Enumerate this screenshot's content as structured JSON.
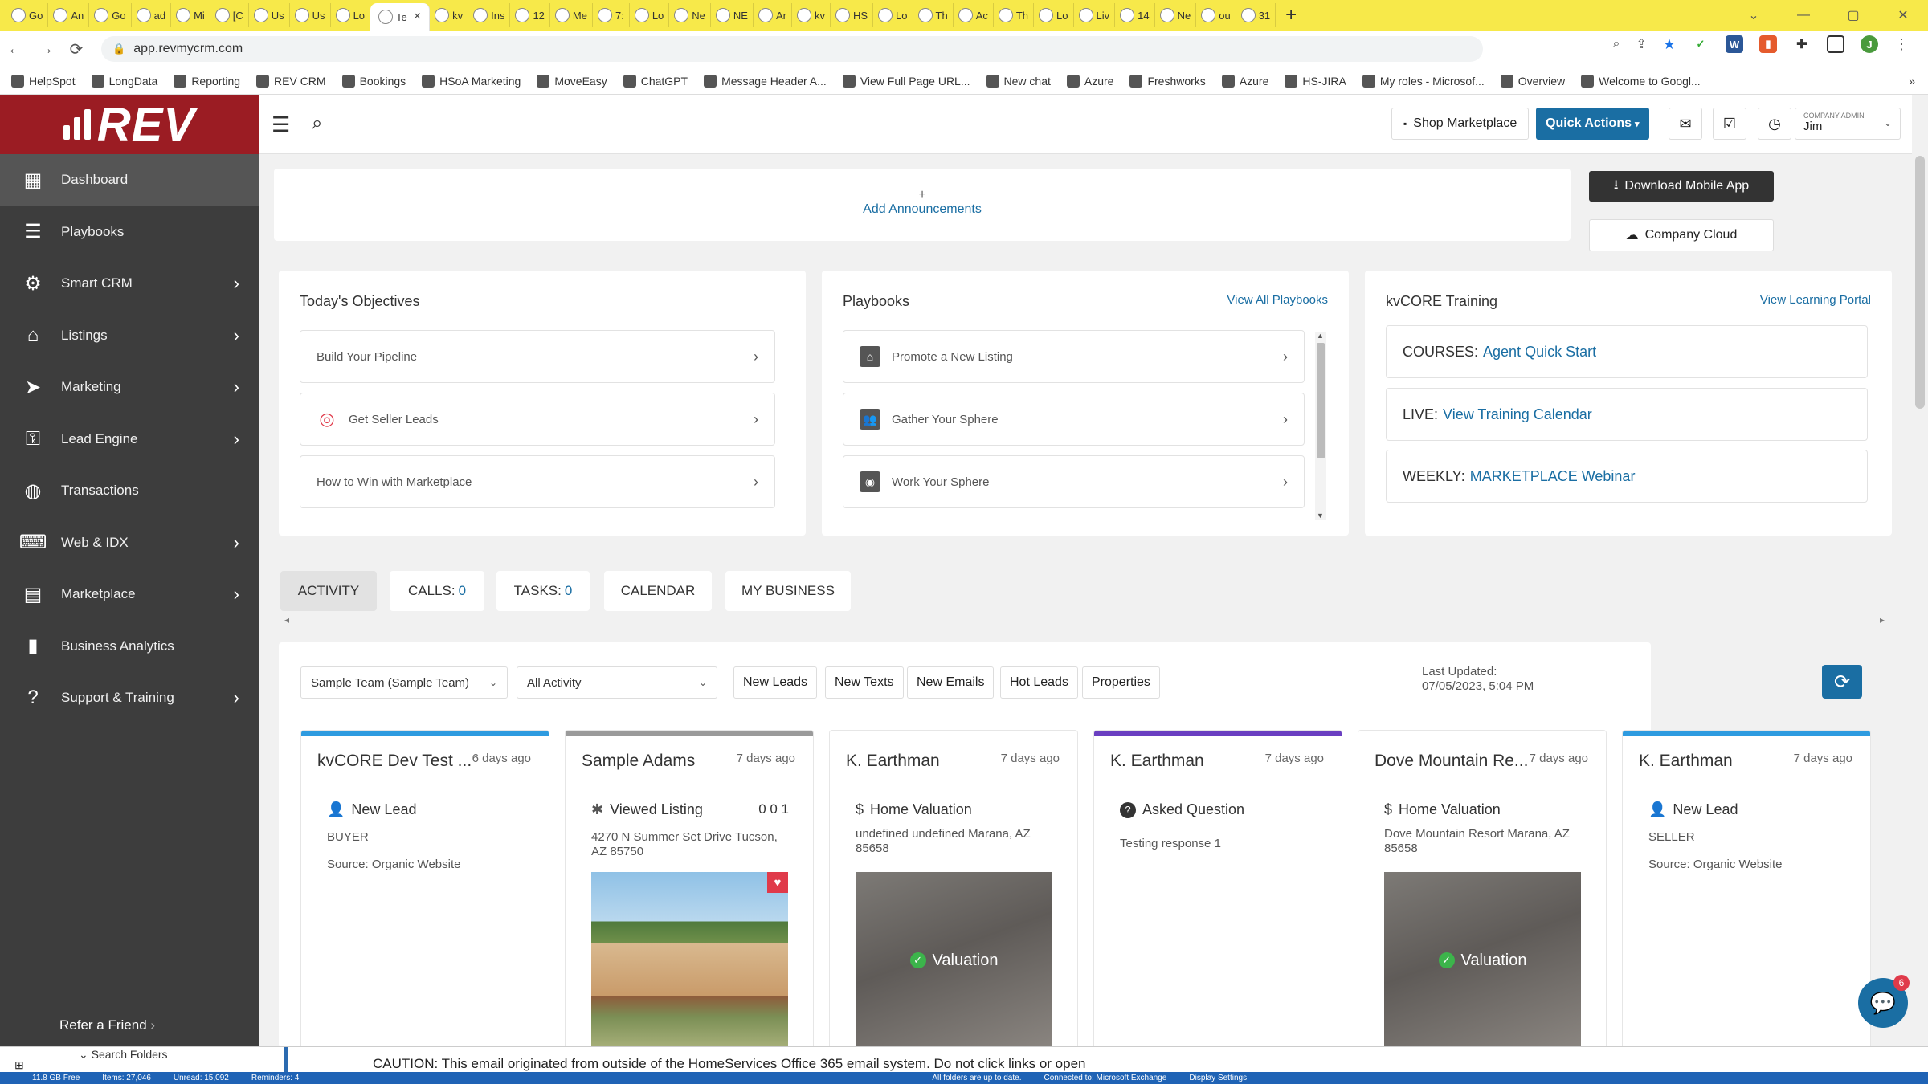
{
  "browser": {
    "tabs": [
      "Go",
      "An",
      "Go",
      "ad",
      "Mi",
      "[C",
      "Us",
      "Us",
      "Lo",
      "Te",
      "kv",
      "Ins",
      "12",
      "Me",
      "7:",
      "Lo",
      "Ne",
      "NE",
      "Ar",
      "kv",
      "HS",
      "Lo",
      "Th",
      "Ac",
      "Th",
      "Lo",
      "Liv",
      "14",
      "Ne",
      "ou",
      "31"
    ],
    "active_tab_index": 9,
    "url": "app.revmycrm.com",
    "bookmarks": [
      "HelpSpot",
      "LongData",
      "Reporting",
      "REV CRM",
      "Bookings",
      "HSoA Marketing",
      "MoveEasy",
      "ChatGPT",
      "Message Header A...",
      "View Full Page URL...",
      "New chat",
      "Azure",
      "Freshworks",
      "Azure",
      "HS-JIRA",
      "My roles - Microsof...",
      "Overview",
      "Welcome to Googl..."
    ],
    "profile_initial": "J"
  },
  "brand": {
    "logo_text": "REV",
    "primary_color": "#9b1c23",
    "accent_color": "#1a6ea3"
  },
  "sidebar": {
    "items": [
      {
        "label": "Dashboard",
        "icon": "dashboard-icon",
        "has_children": false,
        "active": true
      },
      {
        "label": "Playbooks",
        "icon": "playbooks-icon",
        "has_children": false
      },
      {
        "label": "Smart CRM",
        "icon": "crm-gear-icon",
        "has_children": true
      },
      {
        "label": "Listings",
        "icon": "home-icon",
        "has_children": true
      },
      {
        "label": "Marketing",
        "icon": "paper-plane-icon",
        "has_children": true
      },
      {
        "label": "Lead Engine",
        "icon": "lead-engine-icon",
        "has_children": true
      },
      {
        "label": "Transactions",
        "icon": "transactions-icon",
        "has_children": false
      },
      {
        "label": "Web & IDX",
        "icon": "web-icon",
        "has_children": true
      },
      {
        "label": "Marketplace",
        "icon": "store-icon",
        "has_children": true
      },
      {
        "label": "Business Analytics",
        "icon": "bar-chart-icon",
        "has_children": false
      },
      {
        "label": "Support & Training",
        "icon": "help-icon",
        "has_children": true
      }
    ],
    "refer_label": "Refer a Friend",
    "refer_arrow": "›"
  },
  "header": {
    "shop_label": "Shop Marketplace",
    "quick_actions_label": "Quick Actions",
    "user_role": "COMPANY ADMIN",
    "user_name": "Jim"
  },
  "announcements": {
    "plus": "+",
    "label": "Add Announcements"
  },
  "side_buttons": {
    "download_app": "Download Mobile App",
    "company_cloud": "Company Cloud"
  },
  "objectives": {
    "title": "Today's Objectives",
    "items": [
      "Build Your Pipeline",
      "Get Seller Leads",
      "How to Win with Marketplace"
    ]
  },
  "playbooks": {
    "title": "Playbooks",
    "link": "View All Playbooks",
    "items": [
      "Promote a New Listing",
      "Gather Your Sphere",
      "Work Your Sphere"
    ]
  },
  "training": {
    "title": "kvCORE Training",
    "link": "View Learning Portal",
    "items": [
      {
        "prefix": "COURSES:",
        "link": "Agent Quick Start"
      },
      {
        "prefix": "LIVE:",
        "link": "View Training Calendar"
      },
      {
        "prefix": "WEEKLY:",
        "link": "MARKETPLACE Webinar"
      }
    ]
  },
  "tabs": {
    "activity": "ACTIVITY",
    "calls": "CALLS:",
    "calls_count": "0",
    "tasks": "TASKS:",
    "tasks_count": "0",
    "calendar": "CALENDAR",
    "my_business": "MY BUSINESS"
  },
  "filters": {
    "team": "Sample Team (Sample Team)",
    "activity": "All Activity",
    "buttons": [
      "New Leads",
      "New Texts",
      "New Emails",
      "Hot Leads",
      "Properties"
    ],
    "last_updated_label": "Last Updated:",
    "last_updated_value": "07/05/2023, 5:04 PM"
  },
  "leads": [
    {
      "name": "kvCORE Dev Test ...",
      "ago": "6 days ago",
      "event": "New Lead",
      "event_icon": "add-user-icon",
      "line1": "BUYER",
      "line2": "Source: Organic Website",
      "color": "#2e9be0"
    },
    {
      "name": "Sample Adams",
      "ago": "7 days ago",
      "event": "Viewed Listing",
      "event_icon": "pointer-icon",
      "line1": "4270 N Summer Set Drive Tucson, AZ 85750",
      "counts": "0 0 1",
      "color": "#9a9a9a"
    },
    {
      "name": "K. Earthman",
      "ago": "7 days ago",
      "event": "Home Valuation",
      "event_icon": "dollar-icon",
      "line1": "undefined undefined Marana, AZ 85658",
      "overlay": "Valuation",
      "color": "#ffffff"
    },
    {
      "name": "K. Earthman",
      "ago": "7 days ago",
      "event": "Asked Question",
      "event_icon": "question-icon",
      "line1": "Testing response 1",
      "color": "#6a3fc1"
    },
    {
      "name": "Dove Mountain Re...",
      "ago": "7 days ago",
      "event": "Home Valuation",
      "event_icon": "dollar-icon",
      "line1": "Dove Mountain Resort Marana, AZ 85658",
      "overlay": "Valuation",
      "color": "#ffffff"
    },
    {
      "name": "K. Earthman",
      "ago": "7 days ago",
      "event": "New Lead",
      "event_icon": "add-user-icon",
      "line1": "SELLER",
      "line2": "Source: Organic Website",
      "color": "#2e9be0"
    }
  ],
  "chat": {
    "badge": "6"
  },
  "outlook": {
    "search_folders": "Search Folders",
    "caution": "CAUTION: This email originated from outside of the HomeServices Office 365 email system. Do not click links or open",
    "status": [
      "11.8 GB Free",
      "Items: 27,046",
      "Unread: 15,092",
      "Reminders: 4",
      "All folders are up to date.",
      "Connected to: Microsoft Exchange",
      "Display Settings"
    ]
  }
}
